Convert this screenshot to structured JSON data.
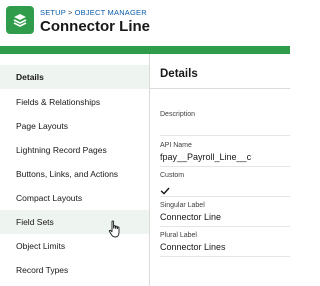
{
  "header": {
    "breadcrumb": {
      "setup": "SETUP",
      "separator": ">",
      "object_manager": "OBJECT MANAGER"
    },
    "title": "Connector Line",
    "app_icon": "layers-icon",
    "accent_color": "#2e9c4a"
  },
  "sidebar": {
    "items": [
      {
        "label": "Details"
      },
      {
        "label": "Fields & Relationships"
      },
      {
        "label": "Page Layouts"
      },
      {
        "label": "Lightning Record Pages"
      },
      {
        "label": "Buttons, Links, and Actions"
      },
      {
        "label": "Compact Layouts"
      },
      {
        "label": "Field Sets"
      },
      {
        "label": "Object Limits"
      },
      {
        "label": "Record Types"
      }
    ],
    "selected": "Details",
    "hovered": "Field Sets"
  },
  "details": {
    "title": "Details",
    "fields": {
      "description": {
        "label": "Description",
        "value": ""
      },
      "api_name": {
        "label": "API Name",
        "value": "fpay__Payroll_Line__c"
      },
      "custom": {
        "label": "Custom",
        "icon": "checkmark-icon",
        "checked": true
      },
      "singular_label": {
        "label": "Singular Label",
        "value": "Connector Line"
      },
      "plural_label": {
        "label": "Plural Label",
        "value": "Connector Lines"
      }
    }
  },
  "cursor": {
    "icon": "hand-pointer-icon"
  }
}
